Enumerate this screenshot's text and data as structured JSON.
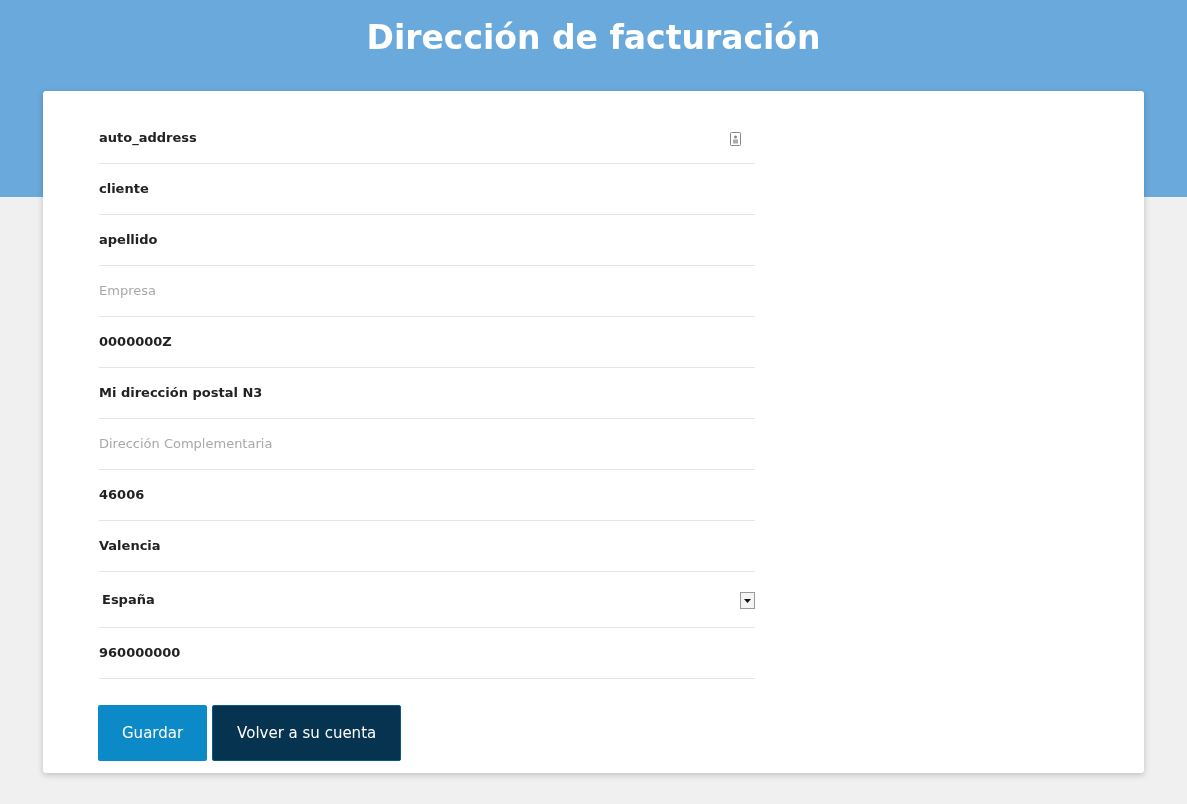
{
  "title": "Dirección de facturación",
  "fields": [
    {
      "kind": "autofill",
      "value": "auto_address"
    },
    {
      "kind": "text",
      "value": "cliente"
    },
    {
      "kind": "text",
      "value": "apellido"
    },
    {
      "kind": "text",
      "placeholder": "Empresa"
    },
    {
      "kind": "text",
      "value": "0000000Z"
    },
    {
      "kind": "text",
      "value": "Mi dirección postal N3"
    },
    {
      "kind": "text",
      "placeholder": "Dirección Complementaria"
    },
    {
      "kind": "text",
      "value": "46006"
    },
    {
      "kind": "text",
      "value": "Valencia"
    },
    {
      "kind": "select",
      "value": "España"
    },
    {
      "kind": "text",
      "value": "960000000"
    }
  ],
  "buttons": [
    {
      "kind": "primary",
      "label": "Guardar"
    },
    {
      "kind": "secondary",
      "label": "Volver a su cuenta"
    }
  ]
}
